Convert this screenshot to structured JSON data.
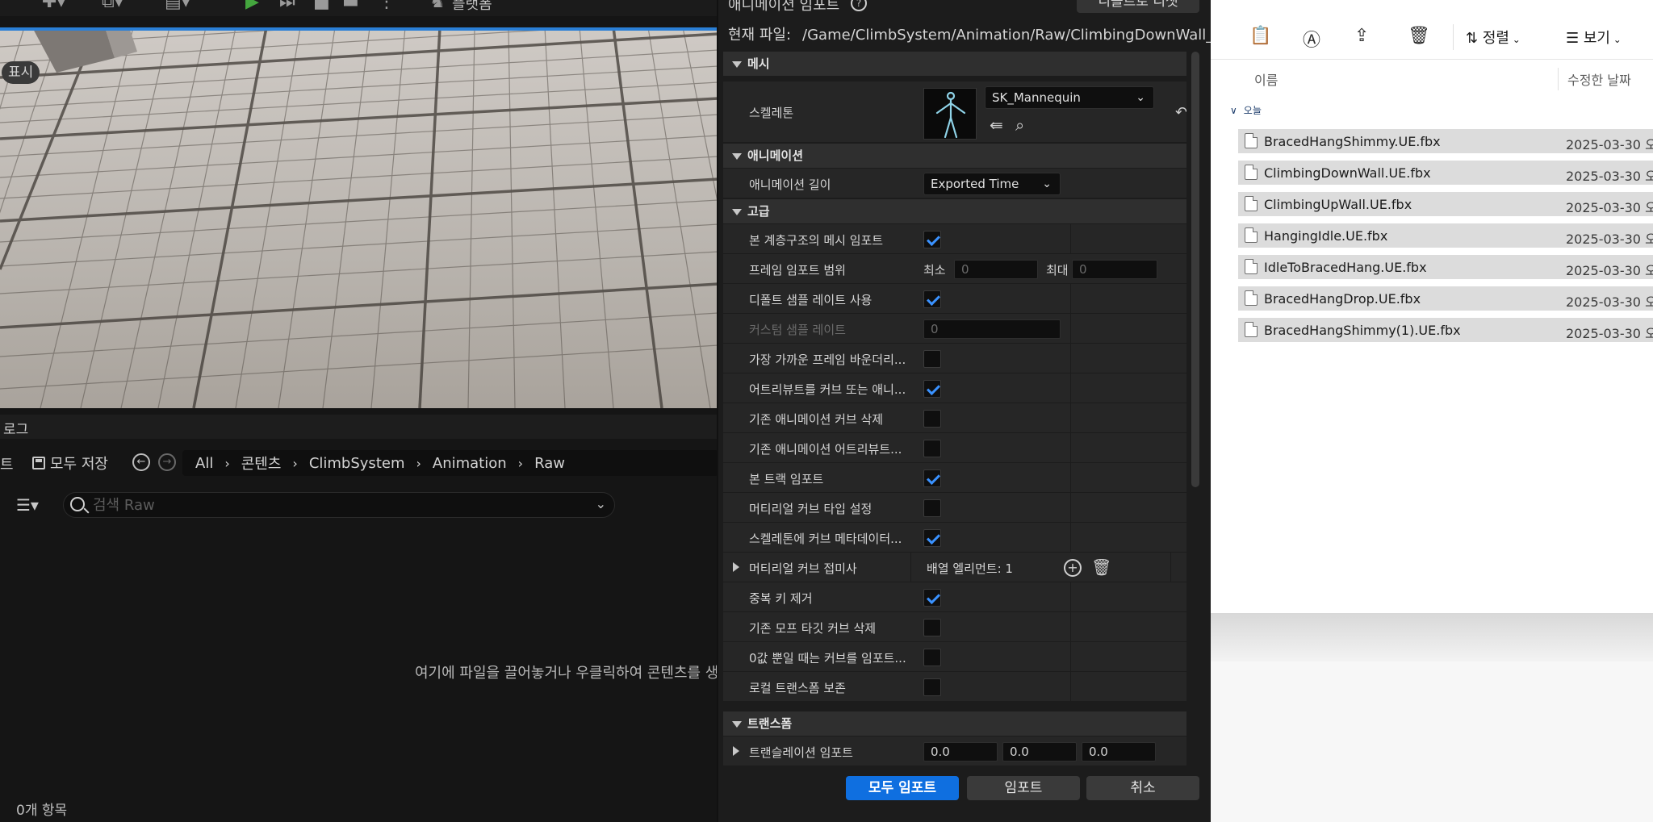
{
  "editor": {
    "platforms_label": "플랫폼",
    "viewport_badge": "표시",
    "log_tab": "로그",
    "content_browser": {
      "left_stub": "트",
      "save_all": "모두 저장",
      "breadcrumb": [
        "All",
        "콘텐츠",
        "ClimbSystem",
        "Animation",
        "Raw"
      ],
      "search_placeholder": "검색 Raw",
      "empty_hint": "여기에 파일을 끌어놓거나 우클릭하여 콘텐츠를 생",
      "item_count": "0개 항목"
    }
  },
  "dialog": {
    "title": "애니메이션 임포트",
    "reset_default": "디폴트로 리셋",
    "current_file_label": "현재 파일:",
    "current_file_path": "/Game/ClimbSystem/Animation/Raw/ClimbingDownWall_UE",
    "sections": {
      "mesh": "메시",
      "animation": "애니메이션",
      "advanced": "고급",
      "transform": "트랜스폼"
    },
    "skeleton": {
      "label": "스켈레톤",
      "value": "SK_Mannequin"
    },
    "animation_length": {
      "label": "애니메이션 길이",
      "value": "Exported Time"
    },
    "frame_range": {
      "label": "프레임 임포트 범위",
      "min_label": "최소",
      "min_value": "0",
      "max_label": "최대",
      "max_value": "0"
    },
    "custom_sample_rate": {
      "label": "커스텀 샘플 레이트",
      "value": "0"
    },
    "checkbox_rows": [
      {
        "label": "본 계층구조의 메시 임포트",
        "checked": true
      },
      {
        "label": "디폴트 샘플 레이트 사용",
        "checked": true
      },
      {
        "label": "가장 가까운 프레임 바운더리...",
        "checked": false
      },
      {
        "label": "어트리뷰트를 커브 또는 애니...",
        "checked": true
      },
      {
        "label": "기존 애니메이션 커브 삭제",
        "checked": false
      },
      {
        "label": "기존 애니메이션 어트리뷰트...",
        "checked": false
      },
      {
        "label": "본 트랙 임포트",
        "checked": true
      },
      {
        "label": "머티리얼 커브 타입 설정",
        "checked": false
      },
      {
        "label": "스켈레톤에 커브 메타데이터...",
        "checked": true
      }
    ],
    "material_curve_suffix": {
      "label": "머티리얼 커브 접미사",
      "value": "배열 엘리먼트: 1"
    },
    "checkbox_rows_2": [
      {
        "label": "중복 키 제거",
        "checked": true
      },
      {
        "label": "기존 모프 타깃 커브 삭제",
        "checked": false
      },
      {
        "label": "0값 뿐일 때는 커브를 임포트...",
        "checked": false
      },
      {
        "label": "로컬 트랜스폼 보존",
        "checked": false
      }
    ],
    "translation_import": {
      "label": "트랜슬레이션 임포트",
      "x": "0.0",
      "y": "0.0",
      "z": "0.0"
    },
    "buttons": {
      "import_all": "모두 임포트",
      "import": "임포트",
      "cancel": "취소"
    }
  },
  "explorer": {
    "sort_label": "정렬",
    "view_label": "보기",
    "col_name": "이름",
    "col_date": "수정한 날짜",
    "group_today": "오늘",
    "files": [
      {
        "name": "BracedHangShimmy.UE.fbx",
        "date": "2025-03-30 오"
      },
      {
        "name": "ClimbingDownWall.UE.fbx",
        "date": "2025-03-30 오"
      },
      {
        "name": "ClimbingUpWall.UE.fbx",
        "date": "2025-03-30 오"
      },
      {
        "name": "HangingIdle.UE.fbx",
        "date": "2025-03-30 오"
      },
      {
        "name": "IdleToBracedHang.UE.fbx",
        "date": "2025-03-30 오"
      },
      {
        "name": "BracedHangDrop.UE.fbx",
        "date": "2025-03-30 오"
      },
      {
        "name": "BracedHangShimmy(1).UE.fbx",
        "date": "2025-03-30 오"
      }
    ]
  }
}
